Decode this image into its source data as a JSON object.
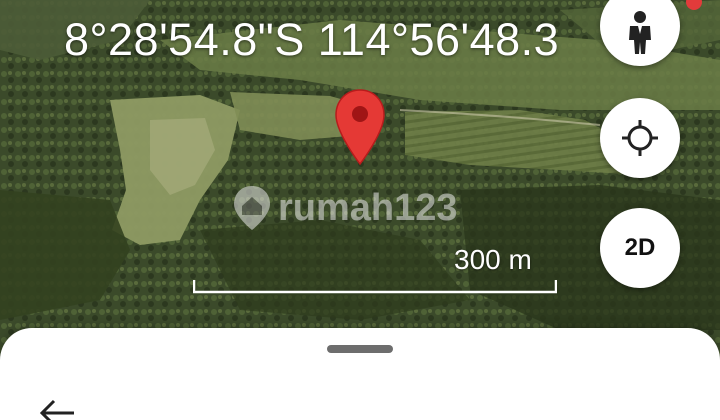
{
  "map": {
    "coordinates": "8°28'54.8\"S 114°56'48.3",
    "scale_label": "300 m",
    "watermark": "rumah123",
    "marker_icon": "location-pin-icon",
    "colors": {
      "pin": "#e53935",
      "pin_dot": "#a01515",
      "overlay_text": "#ffffff"
    }
  },
  "controls": {
    "street_view_icon": "person-icon",
    "locate_icon": "crosshair-icon",
    "mode_label": "2D"
  },
  "sheet": {
    "back_icon": "arrow-left-icon"
  }
}
